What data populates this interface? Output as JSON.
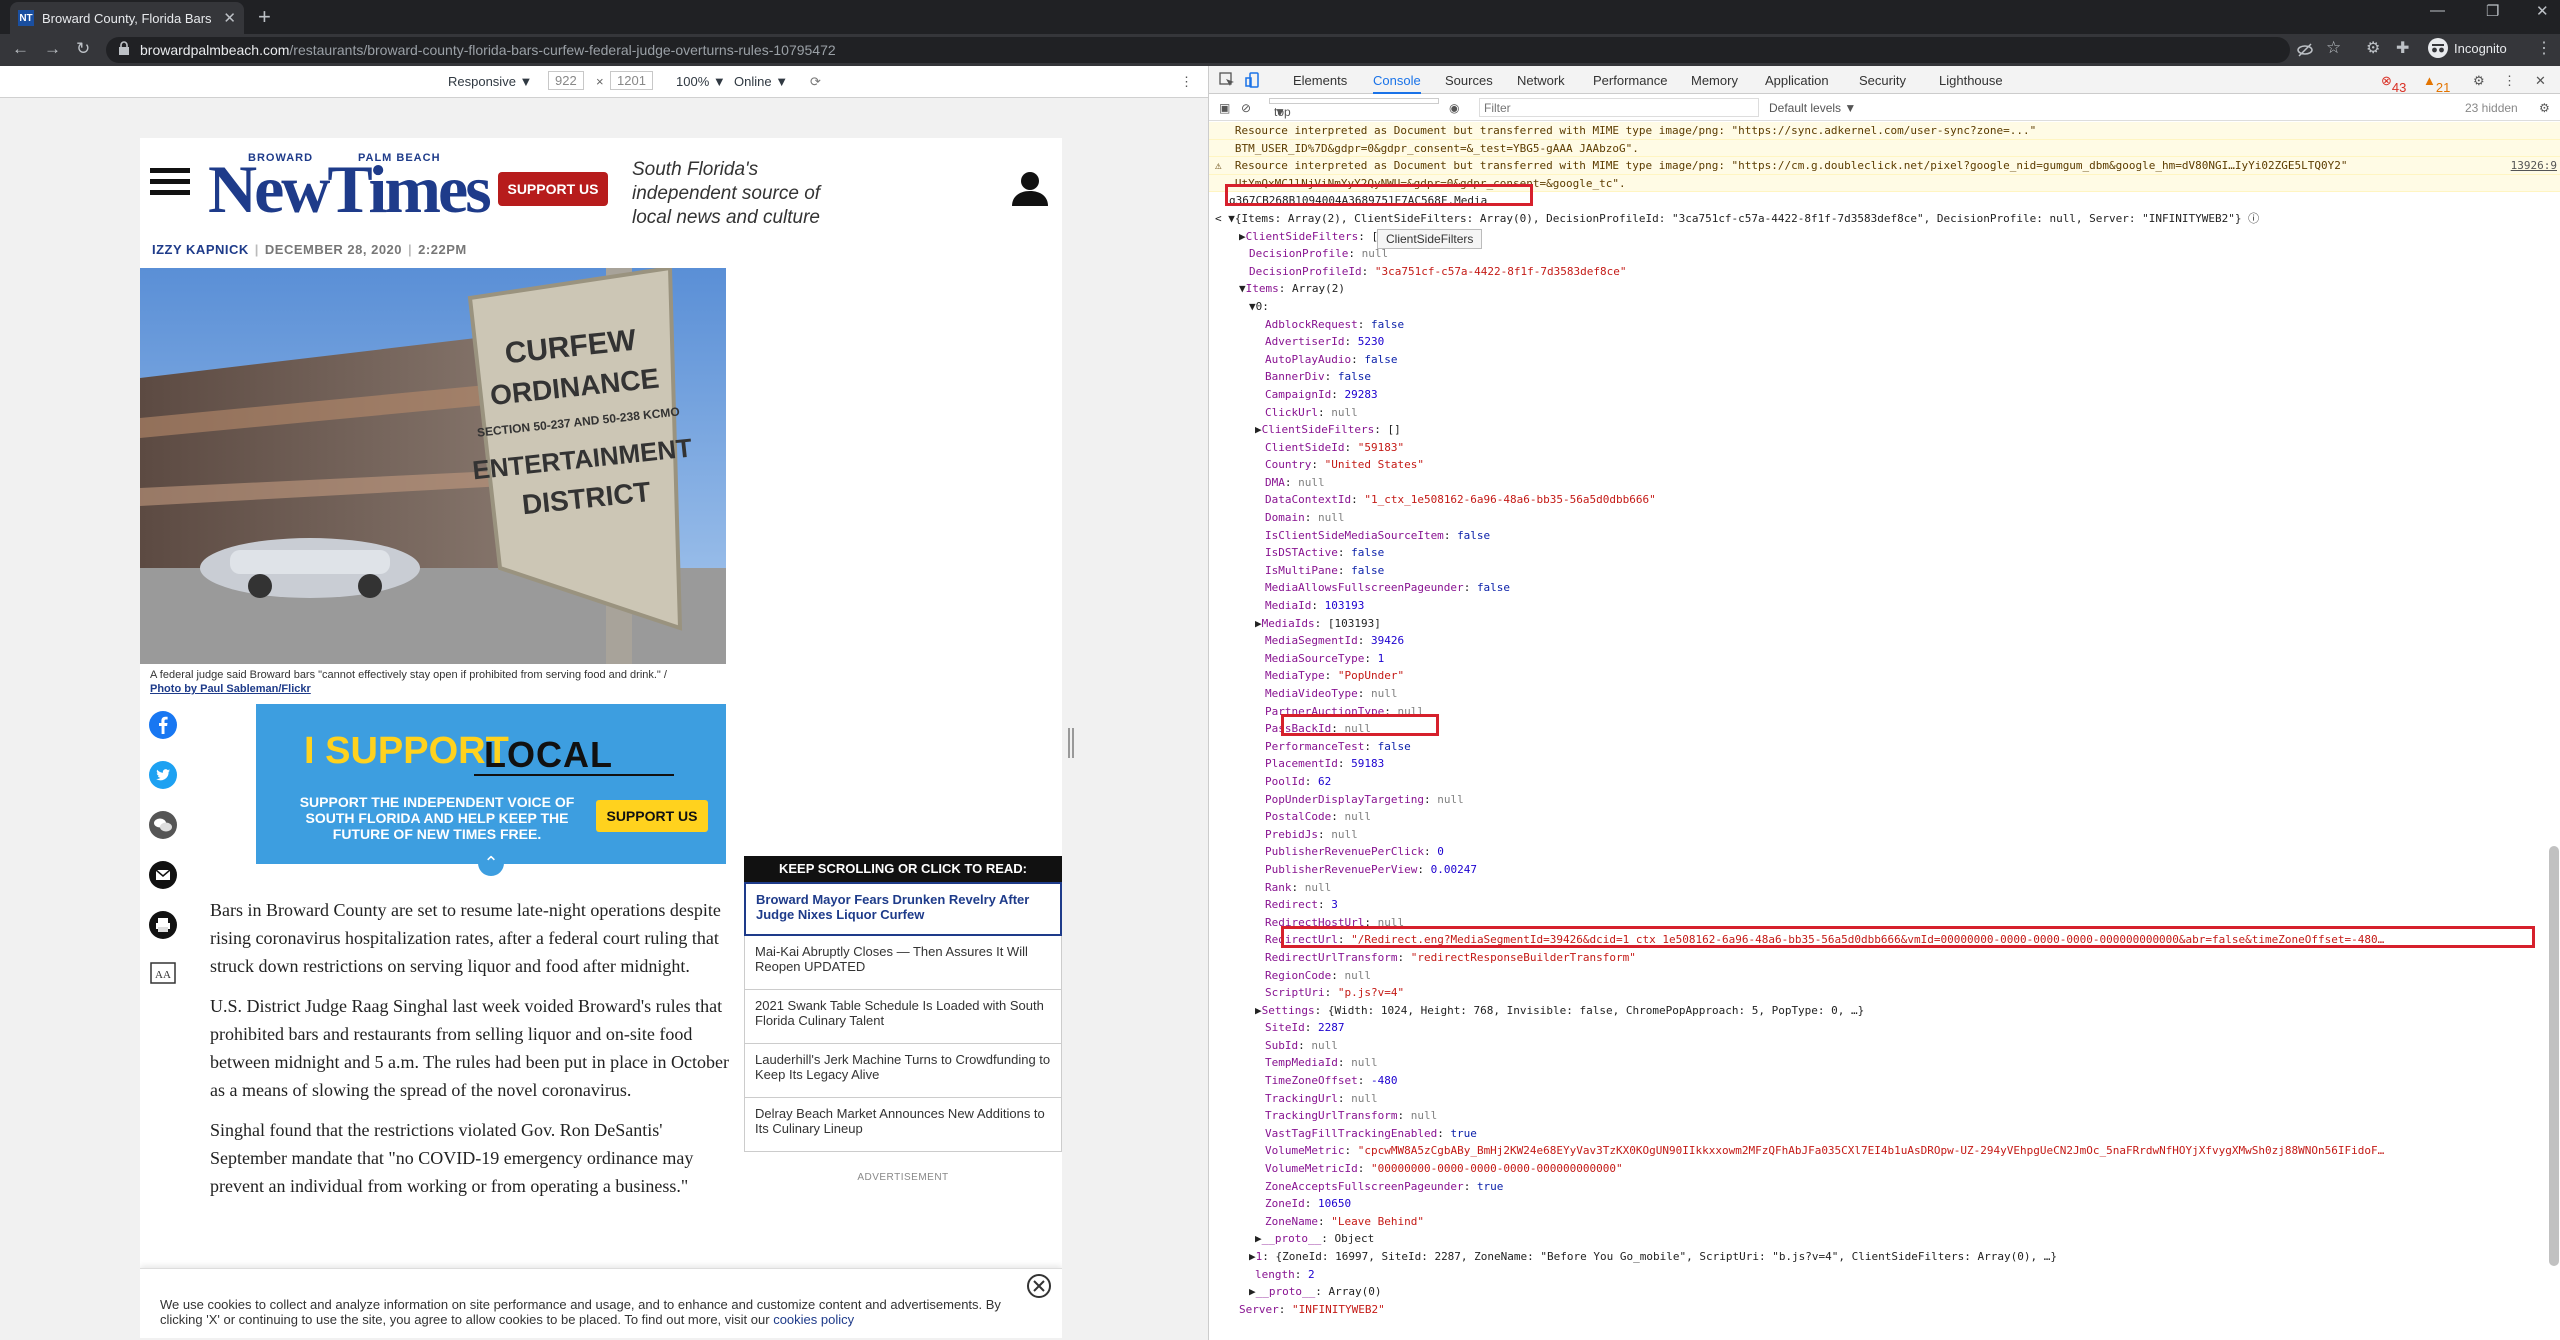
{
  "browser": {
    "tab_title": "Broward County, Florida Bars Cu",
    "url_host": "browardpalmbeach.com",
    "url_path": "/restaurants/broward-county-florida-bars-curfew-federal-judge-overturns-rules-10795472",
    "profile_label": "Incognito"
  },
  "device_toolbar": {
    "mode": "Responsive ▼",
    "width": "922",
    "times": "×",
    "height": "1201",
    "zoom": "100% ▼",
    "network": "Online ▼"
  },
  "site": {
    "logo_broward": "BROWARD",
    "logo_palmbeach": "PALM BEACH",
    "logo_main": "NewTimes",
    "support_label": "SUPPORT US",
    "tagline": "South Florida's independent source of local news and culture",
    "author": "IZZY KAPNICK",
    "date": "DECEMBER 28, 2020",
    "time": "2:22PM",
    "photo_sign": [
      "CURFEW",
      "ORDINANCE",
      "SECTION 50-237 AND 50-238 KCMO",
      "ENTERTAINMENT",
      "DISTRICT"
    ],
    "caption_text": "A federal judge said Broward bars \"cannot effectively stay open if prohibited from serving food and drink.\" /",
    "caption_credit": "Photo by Paul Sableman/Flickr",
    "banner": {
      "i_support": "I SUPPORT",
      "local": "LOCAL",
      "text": "SUPPORT THE INDEPENDENT VOICE OF SOUTH FLORIDA AND HELP KEEP THE FUTURE OF NEW TIMES FREE.",
      "button": "SUPPORT US"
    },
    "paragraphs": [
      "Bars in Broward County are set to resume late-night operations despite rising coronavirus hospitalization rates, after a federal court ruling that struck down restrictions on serving liquor and food after midnight.",
      "U.S. District Judge Raag Singhal last week voided Broward's rules that prohibited bars and restaurants from selling liquor and on-site food between midnight and 5 a.m. The rules had been put in place in October as a means of slowing the spread of the novel coronavirus.",
      "Singhal found that the restrictions violated Gov. Ron DeSantis' September mandate that \"no COVID-19 emergency ordinance may prevent an individual from working or from operating a business.\""
    ],
    "sidebox_head": "KEEP SCROLLING OR CLICK TO READ:",
    "sidebox_items": [
      "Broward Mayor Fears Drunken Revelry After Judge Nixes Liquor Curfew",
      "Mai-Kai Abruptly Closes — Then Assures It Will Reopen UPDATED",
      "2021 Swank Table Schedule Is Loaded with South Florida Culinary Talent",
      "Lauderhill's Jerk Machine Turns to Crowdfunding to Keep Its Legacy Alive",
      "Delray Beach Market Announces New Additions to Its Culinary Lineup"
    ],
    "advert_label": "ADVERTISEMENT",
    "cookie_text": "We use cookies to collect and analyze information on site performance and usage, and to enhance and customize content and advertisements. By clicking 'X' or continuing to use the site, you agree to allow cookies to be placed. To find out more, visit our",
    "cookie_link": "cookies policy"
  },
  "devtools": {
    "tabs": [
      "Elements",
      "Console",
      "Sources",
      "Network",
      "Performance",
      "Memory",
      "Application",
      "Security",
      "Lighthouse"
    ],
    "errors": "43",
    "warnings": "21",
    "context": "top",
    "filter_placeholder": "Filter",
    "levels": "Default levels ▼",
    "hidden": "23 hidden",
    "tooltip": "ClientSideFilters"
  },
  "console_lines": [
    {
      "t": "warn",
      "x": 6,
      "text": "   Resource interpreted as Document but transferred with MIME type image/png: \"https://sync.adkernel.com/user-sync?zone=...\""
    },
    {
      "t": "warn",
      "x": 6,
      "text": "   BTM_USER_ID%7D&gdpr=0&gdpr_consent=&_test=YBG5-gAAA JAAbzoG\"."
    },
    {
      "t": "warn",
      "x": 6,
      "text": "⚠  Resource interpreted as Document but transferred with MIME type image/png: \"https://cm.g.doubleclick.net/pixel?google_nid=gumgum_dbm&google_hm=dV80NGI…IyYi02ZGE5LTQ0Y2\"",
      "src": "13926:9"
    },
    {
      "t": "warn",
      "x": 6,
      "text": "   UtYmQxMC1lNjViNmYyY2QyNWU=&gdpr=0&gdpr_consent=&google_tc\"."
    },
    {
      "t": "plain",
      "x": 20,
      "text": "g367CB268B1094004A3689751E7AC568F.Media"
    },
    {
      "t": "plain",
      "x": 6,
      "text": "< ▼{Items: Array(2), ClientSideFilters: Array(0), DecisionProfileId: \"3ca751cf-c57a-4422-8f1f-7d3583def8ce\", DecisionProfile: null, Server: \"INFINITYWEB2\"} ⓘ"
    },
    {
      "t": "plain",
      "x": 30,
      "text": "▶ClientSideFilters: []"
    },
    {
      "t": "plain",
      "x": 40,
      "text": "DecisionProfile: null"
    },
    {
      "t": "plain",
      "x": 40,
      "text": "DecisionProfileId: \"3ca751cf-c57a-4422-8f1f-7d3583def8ce\""
    },
    {
      "t": "plain",
      "x": 30,
      "text": "▼Items: Array(2)"
    },
    {
      "t": "plain",
      "x": 40,
      "text": "▼0:"
    },
    {
      "t": "plain",
      "x": 56,
      "text": "AdblockRequest: false"
    },
    {
      "t": "plain",
      "x": 56,
      "text": "AdvertiserId: 5230"
    },
    {
      "t": "plain",
      "x": 56,
      "text": "AutoPlayAudio: false"
    },
    {
      "t": "plain",
      "x": 56,
      "text": "BannerDiv: false"
    },
    {
      "t": "plain",
      "x": 56,
      "text": "CampaignId: 29283"
    },
    {
      "t": "plain",
      "x": 56,
      "text": "ClickUrl: null"
    },
    {
      "t": "plain",
      "x": 46,
      "text": "▶ClientSideFilters: []"
    },
    {
      "t": "plain",
      "x": 56,
      "text": "ClientSideId: \"59183\""
    },
    {
      "t": "plain",
      "x": 56,
      "text": "Country: \"United States\""
    },
    {
      "t": "plain",
      "x": 56,
      "text": "DMA: null"
    },
    {
      "t": "plain",
      "x": 56,
      "text": "DataContextId: \"1_ctx_1e508162-6a96-48a6-bb35-56a5d0dbb666\""
    },
    {
      "t": "plain",
      "x": 56,
      "text": "Domain: null"
    },
    {
      "t": "plain",
      "x": 56,
      "text": "IsClientSideMediaSourceItem: false"
    },
    {
      "t": "plain",
      "x": 56,
      "text": "IsDSTActive: false"
    },
    {
      "t": "plain",
      "x": 56,
      "text": "IsMultiPane: false"
    },
    {
      "t": "plain",
      "x": 56,
      "text": "MediaAllowsFullscreenPageunder: false"
    },
    {
      "t": "plain",
      "x": 56,
      "text": "MediaId: 103193"
    },
    {
      "t": "plain",
      "x": 46,
      "text": "▶MediaIds: [103193]"
    },
    {
      "t": "plain",
      "x": 56,
      "text": "MediaSegmentId: 39426"
    },
    {
      "t": "plain",
      "x": 56,
      "text": "MediaSourceType: 1"
    },
    {
      "t": "plain",
      "x": 56,
      "text": "MediaType: \"PopUnder\""
    },
    {
      "t": "plain",
      "x": 56,
      "text": "MediaVideoType: null"
    },
    {
      "t": "plain",
      "x": 56,
      "text": "PartnerAuctionType: null"
    },
    {
      "t": "plain",
      "x": 56,
      "text": "PassBackId: null"
    },
    {
      "t": "plain",
      "x": 56,
      "text": "PerformanceTest: false"
    },
    {
      "t": "plain",
      "x": 56,
      "text": "PlacementId: 59183"
    },
    {
      "t": "plain",
      "x": 56,
      "text": "PoolId: 62"
    },
    {
      "t": "plain",
      "x": 56,
      "text": "PopUnderDisplayTargeting: null"
    },
    {
      "t": "plain",
      "x": 56,
      "text": "PostalCode: null"
    },
    {
      "t": "plain",
      "x": 56,
      "text": "PrebidJs: null"
    },
    {
      "t": "plain",
      "x": 56,
      "text": "PublisherRevenuePerClick: 0"
    },
    {
      "t": "plain",
      "x": 56,
      "text": "PublisherRevenuePerView: 0.00247"
    },
    {
      "t": "plain",
      "x": 56,
      "text": "Rank: null"
    },
    {
      "t": "plain",
      "x": 56,
      "text": "Redirect: 3"
    },
    {
      "t": "plain",
      "x": 56,
      "text": "RedirectHostUrl: null"
    },
    {
      "t": "plain",
      "x": 56,
      "text": "RedirectUrl: \"/Redirect.eng?MediaSegmentId=39426&dcid=1_ctx_1e508162-6a96-48a6-bb35-56a5d0dbb666&vmId=00000000-0000-0000-0000-000000000000&abr=false&timeZoneOffset=-480…"
    },
    {
      "t": "plain",
      "x": 56,
      "text": "RedirectUrlTransform: \"redirectResponseBuilderTransform\""
    },
    {
      "t": "plain",
      "x": 56,
      "text": "RegionCode: null"
    },
    {
      "t": "plain",
      "x": 56,
      "text": "ScriptUri: \"p.js?v=4\""
    },
    {
      "t": "plain",
      "x": 46,
      "text": "▶Settings: {Width: 1024, Height: 768, Invisible: false, ChromePopApproach: 5, PopType: 0, …}"
    },
    {
      "t": "plain",
      "x": 56,
      "text": "SiteId: 2287"
    },
    {
      "t": "plain",
      "x": 56,
      "text": "SubId: null"
    },
    {
      "t": "plain",
      "x": 56,
      "text": "TempMediaId: null"
    },
    {
      "t": "plain",
      "x": 56,
      "text": "TimeZoneOffset: -480"
    },
    {
      "t": "plain",
      "x": 56,
      "text": "TrackingUrl: null"
    },
    {
      "t": "plain",
      "x": 56,
      "text": "TrackingUrlTransform: null"
    },
    {
      "t": "plain",
      "x": 56,
      "text": "VastTagFillTrackingEnabled: true"
    },
    {
      "t": "plain",
      "x": 56,
      "text": "VolumeMetric: \"cpcwMW8A5zCgbABy_BmHj2KW24e68EYyVav3TzKX0KOgUN90IIkkxxowm2MFzQFhAbJFa035CXl7EI4b1uAsDROpw-UZ-294yVEhpgUeCN2JmOc_5naFRrdwNfHOYjXfvygXMwSh0zj88WNOn56IFidoF…"
    },
    {
      "t": "plain",
      "x": 56,
      "text": "VolumeMetricId: \"00000000-0000-0000-0000-000000000000\""
    },
    {
      "t": "plain",
      "x": 56,
      "text": "ZoneAcceptsFullscreenPageunder: true"
    },
    {
      "t": "plain",
      "x": 56,
      "text": "ZoneId: 10650"
    },
    {
      "t": "plain",
      "x": 56,
      "text": "ZoneName: \"Leave Behind\""
    },
    {
      "t": "plain",
      "x": 46,
      "text": "▶__proto__: Object"
    },
    {
      "t": "plain",
      "x": 40,
      "text": "▶1: {ZoneId: 16997, SiteId: 2287, ZoneName: \"Before You Go_mobile\", ScriptUri: \"b.js?v=4\", ClientSideFilters: Array(0), …}"
    },
    {
      "t": "plain",
      "x": 46,
      "text": "length: 2"
    },
    {
      "t": "plain",
      "x": 40,
      "text": "▶__proto__: Array(0)"
    },
    {
      "t": "plain",
      "x": 30,
      "text": "Server: \"INFINITYWEB2\""
    }
  ]
}
